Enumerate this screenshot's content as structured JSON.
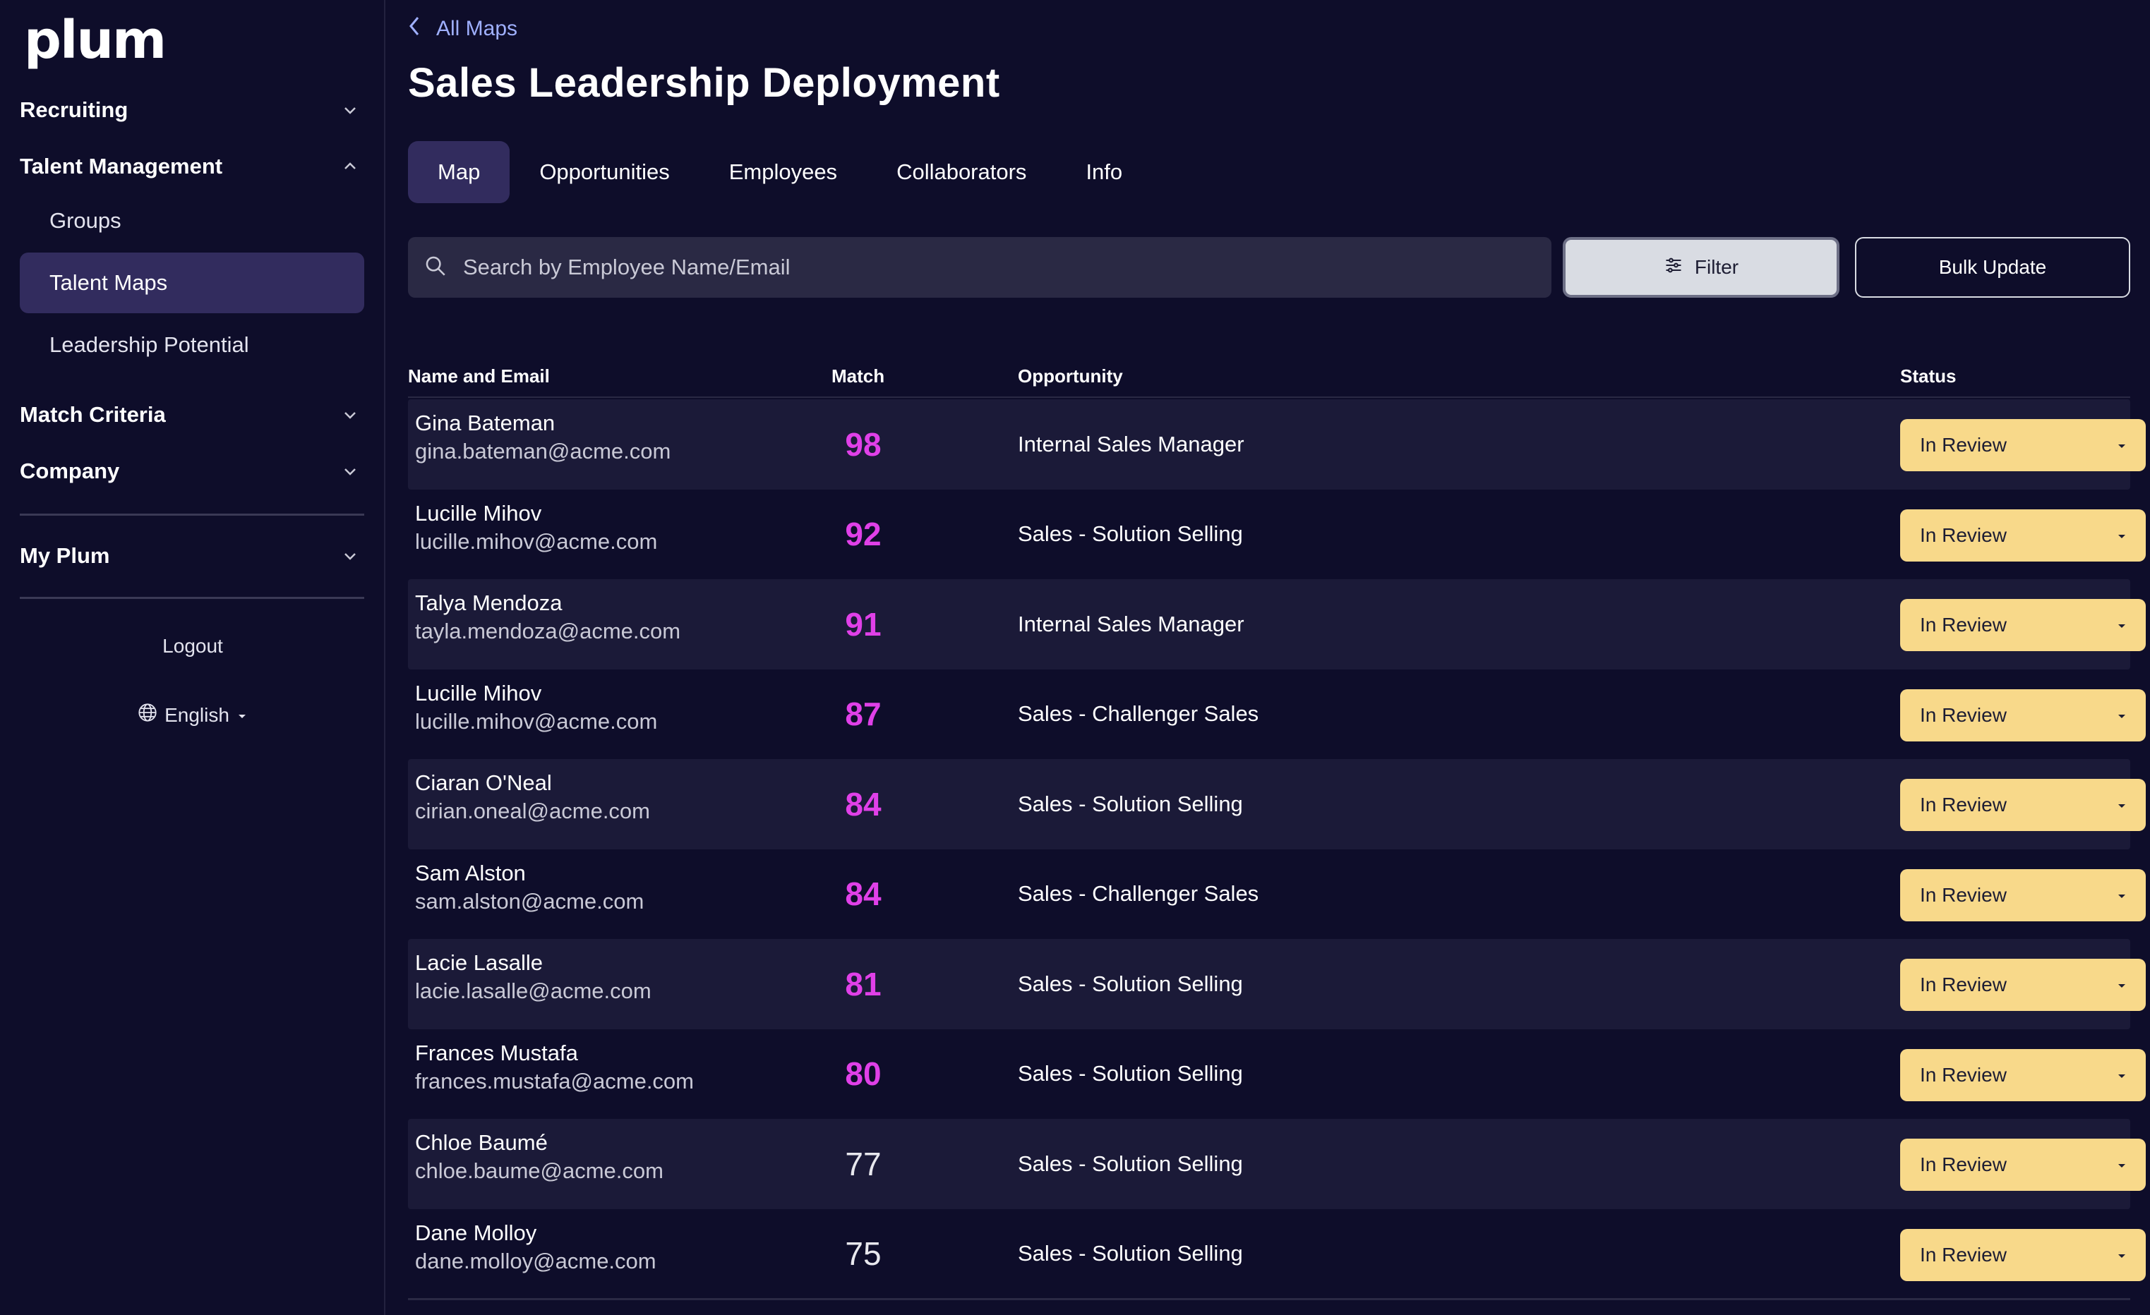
{
  "brand": {
    "logo": "plum"
  },
  "sidebar": {
    "sections": [
      {
        "label": "Recruiting",
        "expanded": false
      },
      {
        "label": "Talent Management",
        "expanded": true
      },
      {
        "label": "Match Criteria",
        "expanded": false
      },
      {
        "label": "Company",
        "expanded": false
      },
      {
        "label": "My Plum",
        "expanded": false
      }
    ],
    "talent_management_items": [
      {
        "label": "Groups",
        "active": false
      },
      {
        "label": "Talent Maps",
        "active": true
      },
      {
        "label": "Leadership Potential",
        "active": false
      }
    ],
    "logout": "Logout",
    "language": "English"
  },
  "header": {
    "back_label": "All Maps",
    "title": "Sales Leadership Deployment"
  },
  "tabs": [
    {
      "label": "Map",
      "active": true
    },
    {
      "label": "Opportunities",
      "active": false
    },
    {
      "label": "Employees",
      "active": false
    },
    {
      "label": "Collaborators",
      "active": false
    },
    {
      "label": "Info",
      "active": false
    }
  ],
  "toolbar": {
    "search_placeholder": "Search by Employee Name/Email",
    "filter_label": "Filter",
    "bulk_update_label": "Bulk Update"
  },
  "table": {
    "columns": [
      "Name and Email",
      "Match",
      "Opportunity",
      "Status"
    ],
    "rows": [
      {
        "name": "Gina Bateman",
        "email": "gina.bateman@acme.com",
        "match": "98",
        "opportunity": "Internal Sales Manager",
        "status": "In Review",
        "highlight": true
      },
      {
        "name": "Lucille Mihov",
        "email": "lucille.mihov@acme.com",
        "match": "92",
        "opportunity": "Sales - Solution Selling",
        "status": "In Review",
        "highlight": true
      },
      {
        "name": "Talya Mendoza",
        "email": "tayla.mendoza@acme.com",
        "match": "91",
        "opportunity": "Internal Sales Manager",
        "status": "In Review",
        "highlight": true
      },
      {
        "name": "Lucille Mihov",
        "email": "lucille.mihov@acme.com",
        "match": "87",
        "opportunity": "Sales - Challenger Sales",
        "status": "In Review",
        "highlight": true
      },
      {
        "name": "Ciaran O'Neal",
        "email": "cirian.oneal@acme.com",
        "match": "84",
        "opportunity": "Sales - Solution Selling",
        "status": "In Review",
        "highlight": true
      },
      {
        "name": "Sam Alston",
        "email": "sam.alston@acme.com",
        "match": "84",
        "opportunity": "Sales - Challenger Sales",
        "status": "In Review",
        "highlight": true
      },
      {
        "name": "Lacie Lasalle",
        "email": "lacie.lasalle@acme.com",
        "match": "81",
        "opportunity": "Sales - Solution Selling",
        "status": "In Review",
        "highlight": true
      },
      {
        "name": "Frances Mustafa",
        "email": "frances.mustafa@acme.com",
        "match": "80",
        "opportunity": "Sales - Solution Selling",
        "status": "In Review",
        "highlight": true
      },
      {
        "name": "Chloe Baumé",
        "email": "chloe.baume@acme.com",
        "match": "77",
        "opportunity": "Sales - Solution Selling",
        "status": "In Review",
        "highlight": false
      },
      {
        "name": "Dane Molloy",
        "email": "dane.molloy@acme.com",
        "match": "75",
        "opportunity": "Sales - Solution Selling",
        "status": "In Review",
        "highlight": false
      }
    ]
  },
  "colors": {
    "background": "#0e0d2a",
    "active_nav": "#322c5e",
    "match_high": "#e040e8",
    "match_normal": "#e8e8ee",
    "status_badge": "#f8d98a",
    "link": "#9fb0ff"
  },
  "icons": [
    "chevron-down-icon",
    "chevron-up-icon",
    "chevron-left-icon",
    "search-icon",
    "sliders-icon",
    "globe-icon",
    "caret-down-icon"
  ]
}
